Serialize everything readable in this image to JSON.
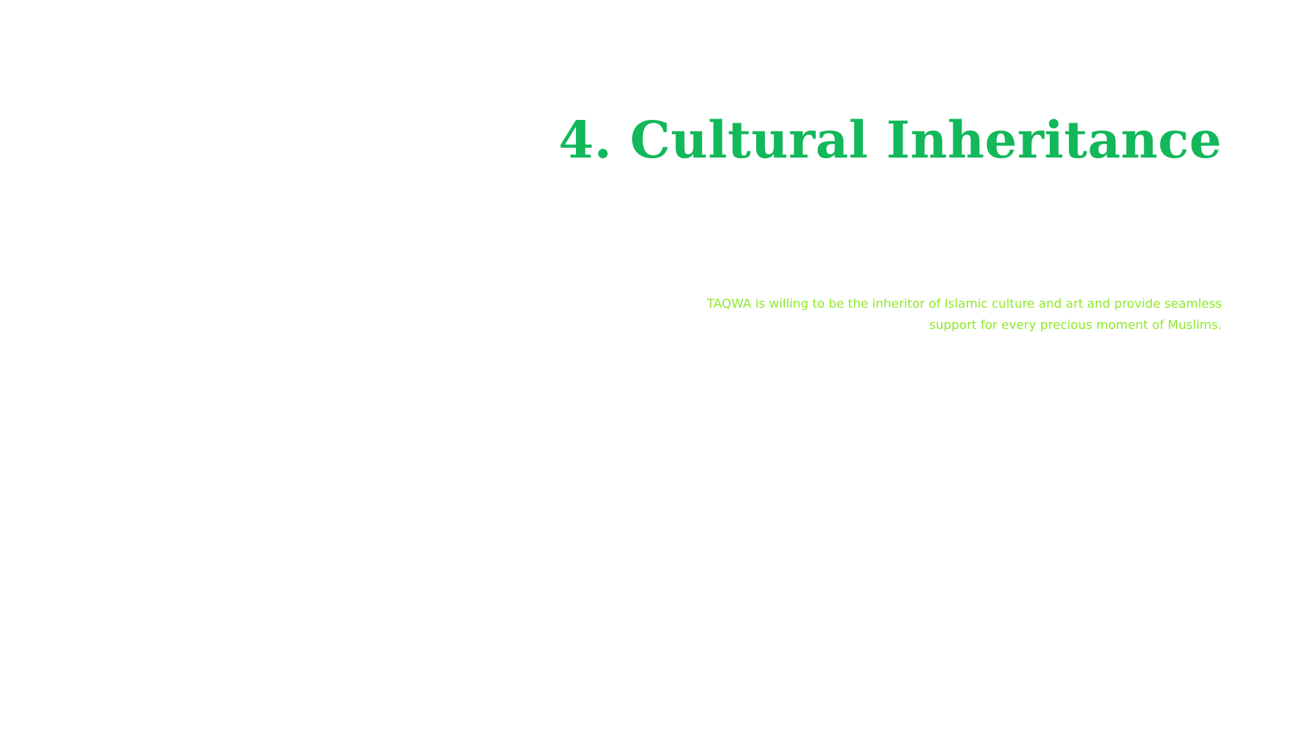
{
  "slide": {
    "title": "4. Cultural Inheritance",
    "body": "TAQWA is willing to be the inheritor of Islamic culture and art and provide seamless support for every precious moment of Muslims."
  },
  "colors": {
    "background": "#ffffff",
    "title": "#12b85a",
    "body": "#8ee82a"
  }
}
